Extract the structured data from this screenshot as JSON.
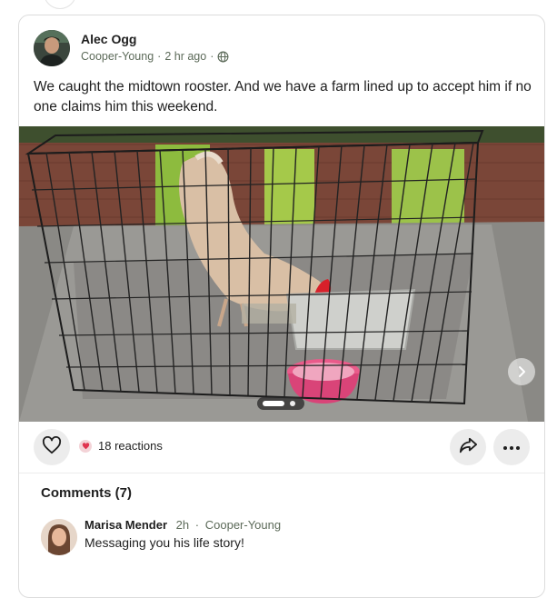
{
  "post": {
    "author": "Alec Ogg",
    "neighborhood": "Cooper-Young",
    "time": "2 hr ago",
    "separator": "·",
    "visibility_icon": "globe-icon",
    "text": "We caught the midtown rooster. And we have a farm lined up to accept him if no one claims him this weekend.",
    "image": {
      "description_icon": "photo",
      "carousel_total": 2,
      "carousel_index": 1
    }
  },
  "actions": {
    "like_icon": "heart-icon",
    "reaction_icon": "heart-reaction-icon",
    "reactions_label": "18 reactions",
    "share_icon": "share-icon",
    "more_icon": "more-icon"
  },
  "comments": {
    "title": "Comments (7)",
    "items": [
      {
        "name": "Marisa Mender",
        "time": "2h",
        "separator": "·",
        "neighborhood": "Cooper-Young",
        "text": "Messaging you his life story!"
      }
    ]
  },
  "colors": {
    "text": "#1f1f1f",
    "meta": "#5d6b5a",
    "button_bg": "#ececec",
    "reaction": "#e0344f",
    "rooster_comb": "#d8202a"
  }
}
